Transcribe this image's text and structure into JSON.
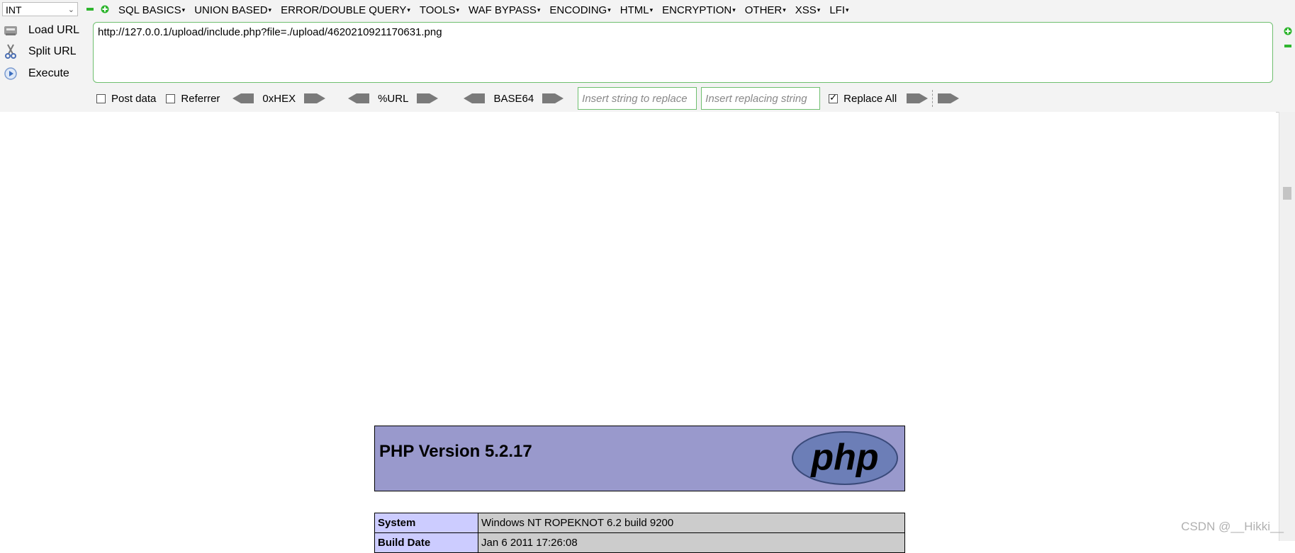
{
  "toolbar": {
    "select_value": "INT",
    "menus": [
      "SQL BASICS",
      "UNION BASED",
      "ERROR/DOUBLE QUERY",
      "TOOLS",
      "WAF BYPASS",
      "ENCODING",
      "HTML",
      "ENCRYPTION",
      "OTHER",
      "XSS",
      "LFI"
    ],
    "load_url": "Load URL",
    "split_url": "Split URL",
    "execute": "Execute",
    "url": "http://127.0.0.1/upload/include.php?file=./upload/4620210921170631.png"
  },
  "options": {
    "post_data": "Post data",
    "referrer": "Referrer",
    "hex": "0xHEX",
    "url_enc": "%URL",
    "base64": "BASE64",
    "insert_replace_placeholder": "Insert string to replace",
    "insert_replacing_placeholder": "Insert replacing string",
    "replace_all": "Replace All"
  },
  "content": {
    "garbled_lines": []
  },
  "phpinfo": {
    "title": "PHP Version 5.2.17",
    "logo_text": "php",
    "rows": [
      {
        "label": "System",
        "value": "Windows NT ROPEKNOT 6.2 build 9200"
      },
      {
        "label": "Build Date",
        "value": "Jan 6 2011 17:26:08"
      }
    ]
  },
  "watermark": "CSDN @__Hikki__",
  "colors": {
    "php_header": "#9999cc",
    "php_label": "#ccccff",
    "php_value": "#cccccc",
    "url_border": "#6fbf6f"
  }
}
